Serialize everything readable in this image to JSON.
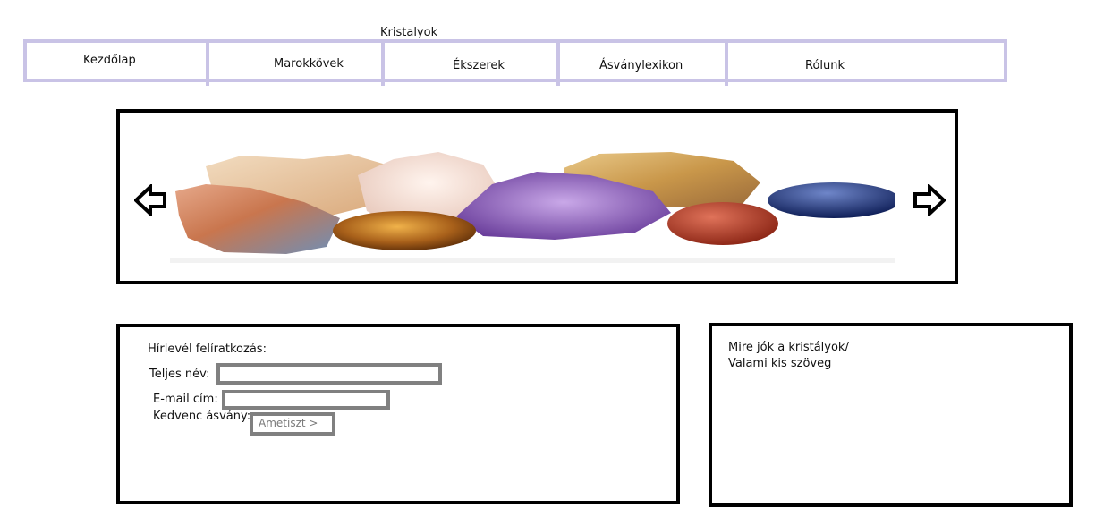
{
  "header": {
    "title": "Kristalyok"
  },
  "nav": {
    "items": [
      {
        "label": "Kezdőlap"
      },
      {
        "label": "Marokkövek"
      },
      {
        "label": "Ékszerek"
      },
      {
        "label": "Ásványlexikon"
      },
      {
        "label": "Rólunk"
      }
    ]
  },
  "slider": {
    "prev_icon": "arrow-left-icon",
    "next_icon": "arrow-right-icon",
    "image": "crystals-banner"
  },
  "newsletter": {
    "title": "Hírlevél felíratkozás:",
    "name_label": "Teljes név:",
    "name_value": "",
    "email_label": "E-mail cím:",
    "email_value": "",
    "favorite_label": "Kedvenc ásvány:",
    "favorite_selected": "Ametiszt >"
  },
  "info": {
    "line1": "Mire jók a kristályok/",
    "line2": "Valami kis szöveg"
  },
  "colors": {
    "nav_border": "#c9c3e6",
    "box_border": "#000000",
    "field_border": "#808080"
  }
}
